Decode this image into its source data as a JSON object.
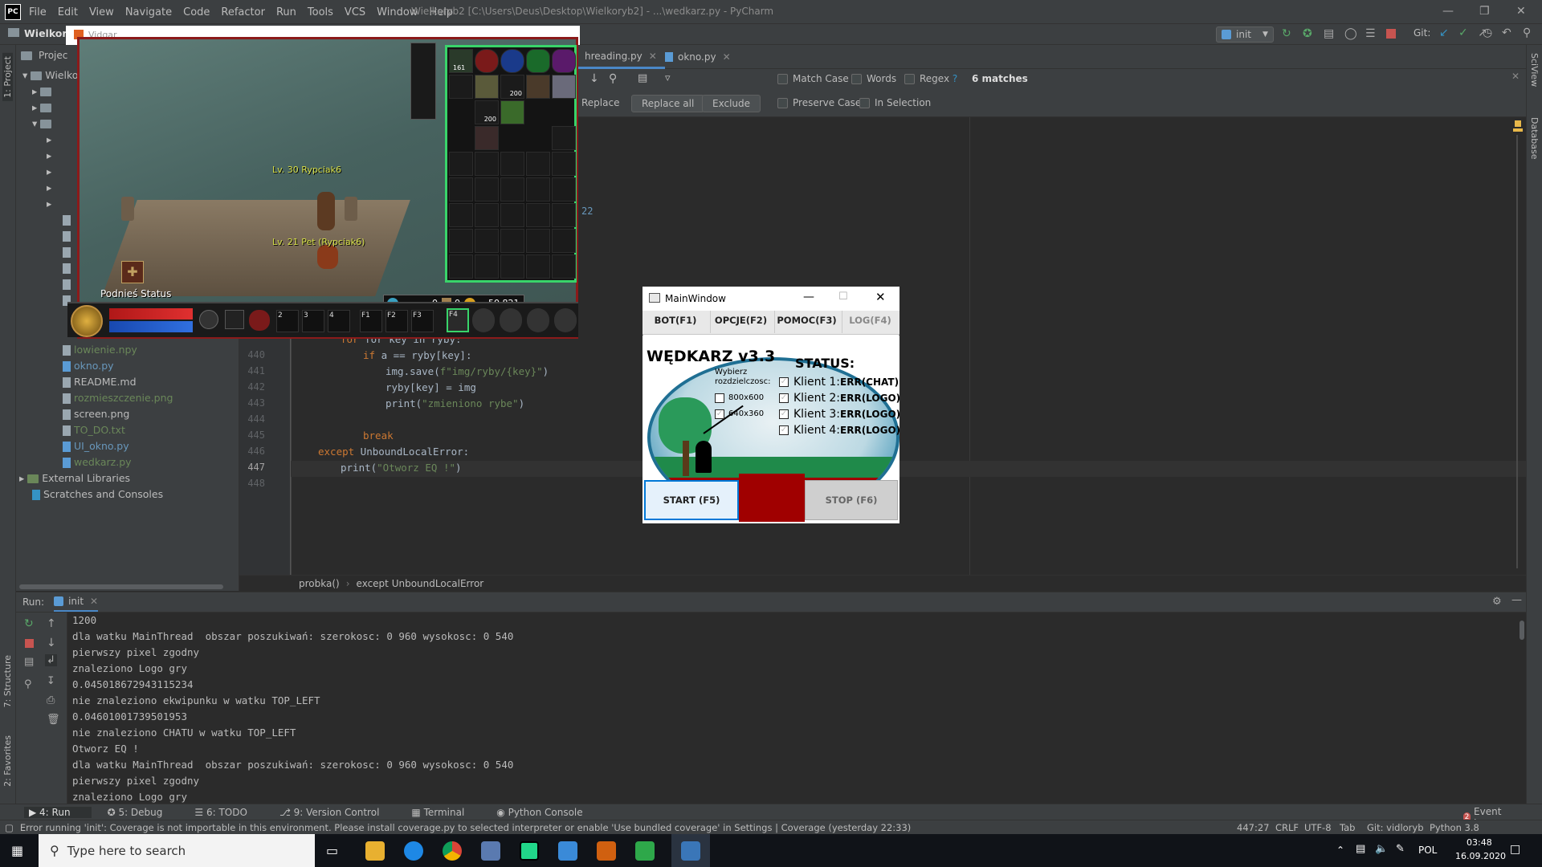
{
  "ide": {
    "title_menu": [
      "File",
      "Edit",
      "View",
      "Navigate",
      "Code",
      "Refactor",
      "Run",
      "Tools",
      "VCS",
      "Window",
      "Help"
    ],
    "window_title": "Wielkoryb2 [C:\\Users\\Deus\\Desktop\\Wielkoryb2] - ...\\wedkarz.py - PyCharm",
    "project_name": "Wielkoryb2",
    "project_name_short": "Wielkory",
    "project_tab_label": "Projec",
    "run_config": "init",
    "git_label": "Git:",
    "tabs": [
      "hreading.py",
      "okno.py"
    ],
    "find": {
      "match_case": "Match Case",
      "words": "Words",
      "regex": "Regex",
      "regex_help": "?",
      "matches": "6 matches",
      "replace": "Replace",
      "replace_all": "Replace all",
      "exclude": "Exclude",
      "preserve_case": "Preserve Case",
      "in_selection": "In Selection"
    },
    "project_tree": [
      {
        "name": "lowienie.npy",
        "color": "#6a8759"
      },
      {
        "name": "okno.py",
        "color": "#6897bb"
      },
      {
        "name": "README.md",
        "color": "#bbbbbb"
      },
      {
        "name": "rozmieszczenie.png",
        "color": "#6a8759"
      },
      {
        "name": "screen.png",
        "color": "#bbbbbb"
      },
      {
        "name": "TO_DO.txt",
        "color": "#6a8759"
      },
      {
        "name": "UI_okno.py",
        "color": "#6897bb"
      },
      {
        "name": "wedkarz.py",
        "color": "#6a8759"
      },
      {
        "name": "External Libraries",
        "color": "#bbbbbb"
      },
      {
        "name": "Scratches and Consoles",
        "color": "#bbbbbb"
      }
    ],
    "line_numbers": [
      "440",
      "441",
      "442",
      "443",
      "444",
      "445",
      "446",
      "447",
      "448"
    ],
    "code_fragment_22": "22",
    "code": {
      "l439": "for key in ryby:",
      "l440a": "if",
      "l440b": " a == ryby[key]:",
      "l441a": "img.save(",
      "l441b": "f\"img/ryby/{key}\"",
      "l441c": ")",
      "l442": "ryby[key] = img",
      "l443a": "print(",
      "l443b": "\"zmieniono rybe\"",
      "l443c": ")",
      "l445": "break",
      "l446a": "except",
      "l446b": " UnboundLocalError:",
      "l447a": "print(",
      "l447b": "\"Otworz EQ !\"",
      "l447c": ")"
    },
    "breadcrumbs": [
      "probka()",
      "except UnboundLocalError"
    ],
    "run_label": "Run:",
    "run_tab": "init",
    "console_lines": [
      "1200",
      "dla watku MainThread  obszar poszukiwań: szerokosc: 0 960 wysokosc: 0 540",
      "pierwszy pixel zgodny",
      "znaleziono Logo gry",
      "0.045018672943115234",
      "nie znaleziono ekwipunku w watku TOP_LEFT",
      "0.04601001739501953",
      "nie znaleziono CHATU w watku TOP_LEFT",
      "Otworz EQ !",
      "dla watku MainThread  obszar poszukiwań: szerokosc: 0 960 wysokosc: 0 540",
      "pierwszy pixel zgodny",
      "znaleziono Logo gry"
    ],
    "left_strip": [
      "1: Project",
      "7: Structure",
      "2: Favorites"
    ],
    "right_strip": [
      "SciView",
      "Database"
    ],
    "bottom_tools": [
      "4: Run",
      "5: Debug",
      "6: TODO",
      "9: Version Control",
      "Terminal",
      "Python Console"
    ],
    "event_log": "Event Log",
    "event_count": "2",
    "status_message": "Error running 'init': Coverage is not importable in this environment. Please install coverage.py to selected interpreter or enable 'Use bundled coverage' in Settings | Coverage (yesterday 22:33)",
    "status_right": [
      "447:27",
      "CRLF",
      "UTF-8",
      "Tab",
      "Git: vidloryb",
      "Python 3.8"
    ]
  },
  "game": {
    "title": "Vidgar",
    "player1": "Lv. 30 Rypciak6",
    "player2": "Lv. 21 Pet (Rypciak6)",
    "status_btn": "Podnieś Status",
    "gold": "50,821",
    "zero1": "0",
    "zero2": "0",
    "stack1": "161",
    "stack2": "200",
    "stack3": "200",
    "hotkeys": [
      "2",
      "3",
      "4",
      "F1",
      "F2",
      "F3",
      "F4"
    ]
  },
  "mainwindow": {
    "title": "MainWindow",
    "tabs": [
      "BOT(F1)",
      "OPCJE(F2)",
      "POMOC(F3)",
      "LOG(F4)"
    ],
    "app_title": "WĘDKARZ v3.3",
    "status_header": "STATUS:",
    "res_label_1": "Wybierz",
    "res_label_2": "rozdzielczosc:",
    "res_options": [
      {
        "label": "800x600",
        "checked": false
      },
      {
        "label": "640x360",
        "checked": true
      }
    ],
    "clients": [
      {
        "name": "Klient 1:",
        "status": "ERR(CHAT)"
      },
      {
        "name": "Klient 2:",
        "status": "ERR(LOGO)"
      },
      {
        "name": "Klient 3:",
        "status": "ERR(LOGO)"
      },
      {
        "name": "Klient 4:",
        "status": "ERR(LOGO)"
      }
    ],
    "start": "START (F5)",
    "stop": "STOP (F6)"
  },
  "taskbar": {
    "search_placeholder": "Type here to search",
    "lang": "POL",
    "time": "03:48",
    "date": "16.09.2020"
  }
}
